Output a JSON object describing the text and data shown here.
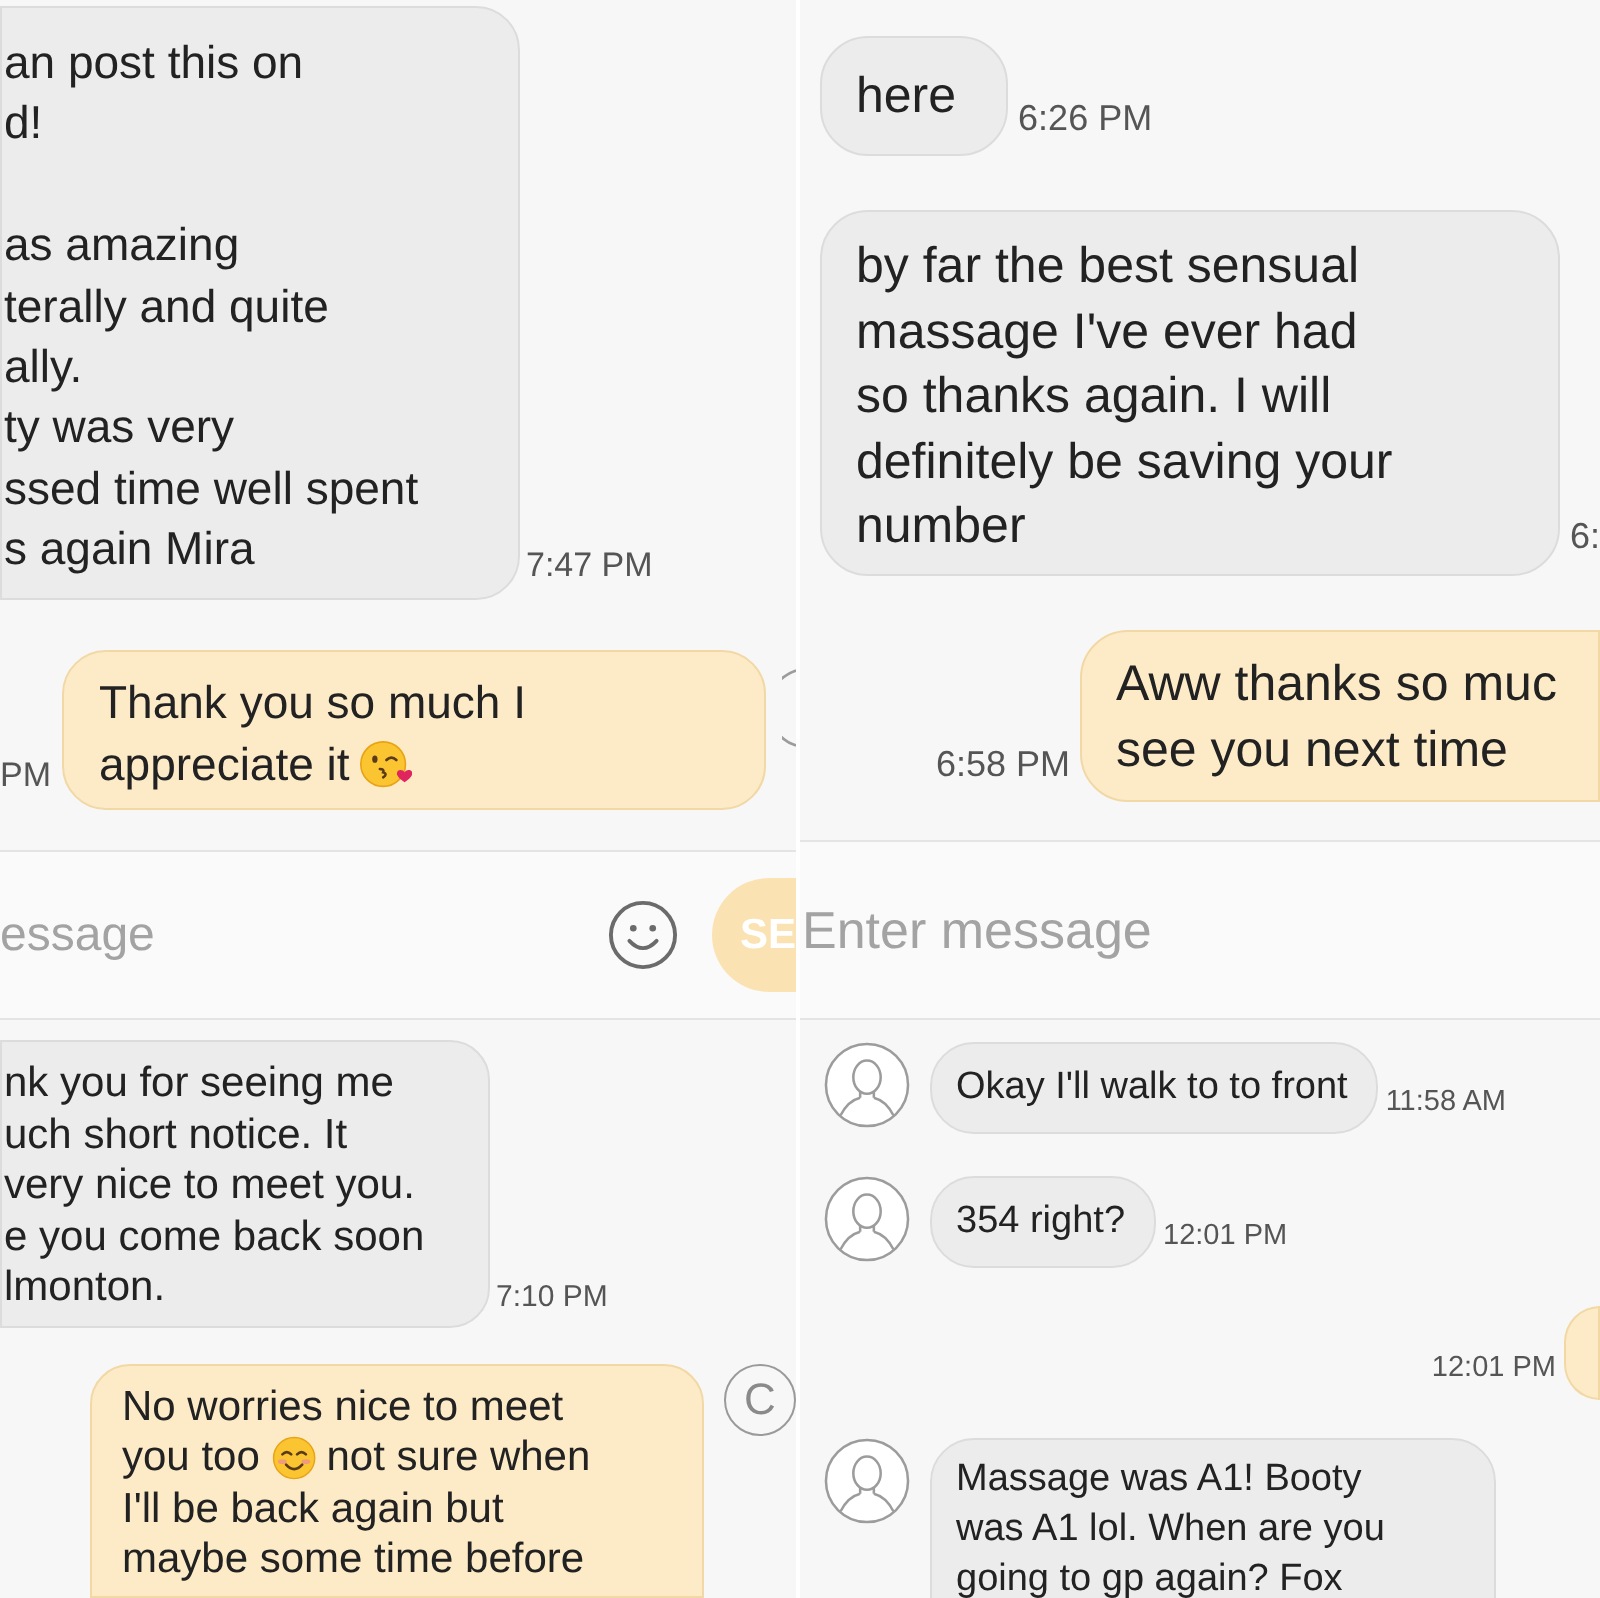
{
  "panels": [
    {
      "messages": [
        {
          "kind": "received",
          "text": "an post this on\nd!\n\nas amazing\nterally and quite\nally.\nty was very\nssed time well spent\ns again Mira",
          "time": "7:47 PM"
        },
        {
          "kind": "sent",
          "segments": [
            {
              "kind": "text",
              "text": "Thank you so much I\nappreciate it"
            },
            {
              "kind": "kiss"
            }
          ],
          "time": "PM",
          "avatar": {
            "kind": "partial"
          }
        }
      ],
      "composer": {
        "placeholder": "essage",
        "emoji_button": true,
        "send_label": "SE"
      }
    },
    {
      "messages": [
        {
          "kind": "received",
          "text": "here",
          "time": "6:26 PM"
        },
        {
          "kind": "received",
          "text": "by far the best sensual\nmassage I've ever had\nso thanks again. I will\ndefinitely be saving your\nnumber",
          "time": "6:"
        },
        {
          "kind": "sent",
          "text": "Aww thanks so muc\nsee you next time",
          "time": "6:58 PM"
        }
      ],
      "composer": {
        "placeholder": "Enter message"
      }
    },
    {
      "messages": [
        {
          "kind": "received",
          "text": "nk you for seeing me\nuch short notice. It\nvery nice to meet you.\ne you come back soon\nlmonton.",
          "time": "7:10 PM"
        },
        {
          "kind": "sent",
          "segments": [
            {
              "kind": "text",
              "text": "No worries nice to meet\nyou too"
            },
            {
              "kind": "smile"
            },
            {
              "kind": "text",
              "text": "not sure when\nI'll be back again but\nmaybe some time before"
            }
          ],
          "avatar": {
            "kind": "letter",
            "letter": "C"
          }
        }
      ]
    },
    {
      "messages": [
        {
          "kind": "received",
          "text": "Okay I'll walk to to front",
          "time": "11:58 AM",
          "avatar": {
            "kind": "silhouette"
          }
        },
        {
          "kind": "received",
          "text": "354 right?",
          "time": "12:01 PM",
          "avatar": {
            "kind": "silhouette"
          }
        },
        {
          "kind": "sent",
          "time": "12:01 PM"
        },
        {
          "kind": "received",
          "text": "Massage was A1! Booty\nwas A1 lol. When are you\ngoing to gp again? Fox",
          "avatar": {
            "kind": "silhouette"
          }
        }
      ]
    }
  ]
}
